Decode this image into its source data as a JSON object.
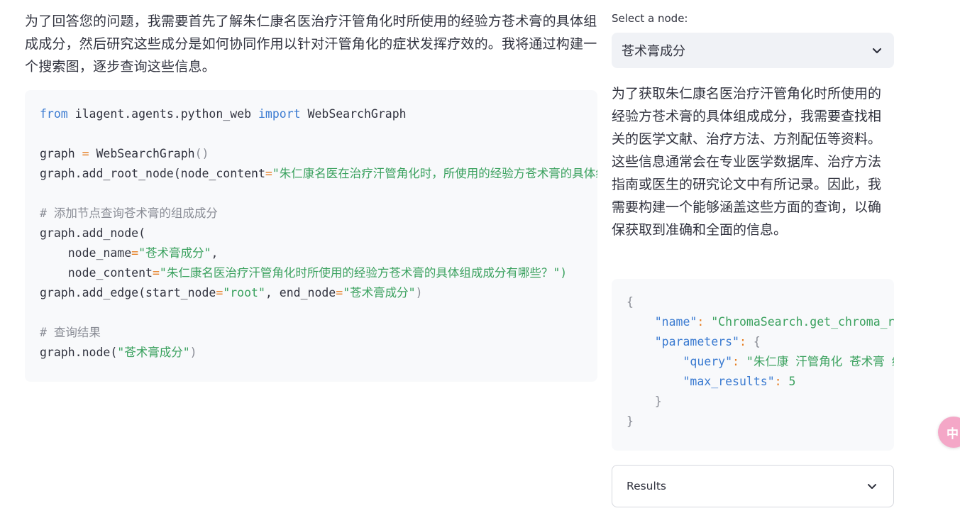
{
  "intro": {
    "text": "为了回答您的问题，我需要首先了解朱仁康名医治疗汗管角化时所使用的经验方苍术膏的具体组成成分，然后研究这些成分是如何协同作用以针对汗管角化的症状发挥疗效的。我将通过构建一个搜索图，逐步查询这些信息。"
  },
  "code": {
    "line1_from": "from",
    "line1_module": " ilagent.agents.python_web ",
    "line1_import": "import",
    "line1_name": " WebSearchGraph",
    "line3_var": "graph",
    "line3_eq": " = ",
    "line3_call": "WebSearchGraph",
    "line3_paren": "()",
    "line4_call": "graph.add_root_node(node_content",
    "line4_eq": "=",
    "line4_str": "\"朱仁康名医在治疗汗管角化时，所使用的经验方苍术膏的具体组成成分有哪些？\"",
    "line6_comment": "# 添加节点查询苍术膏的组成成分",
    "line7_call": "graph.add_node(",
    "line8_key": "    node_name",
    "line8_eq": "=",
    "line8_str": "\"苍术膏成分\"",
    "line8_comma": ",",
    "line9_key": "    node_content",
    "line9_eq": "=",
    "line9_str": "\"朱仁康名医治疗汗管角化时所使用的经验方苍术膏的具体组成成分有哪些？\")",
    "line10_call": "graph.add_edge(start_node",
    "line10_eq1": "=",
    "line10_str1": "\"root\"",
    "line10_mid": ", end_node",
    "line10_eq2": "=",
    "line10_str2": "\"苍术膏成分\"",
    "line10_close": ")",
    "line12_comment": "# 查询结果",
    "line13_call": "graph.node(",
    "line13_str": "\"苍术膏成分\"",
    "line13_close": ")"
  },
  "selector": {
    "label": "Select a node:",
    "value": "苍术膏成分"
  },
  "description": "为了获取朱仁康名医治疗汗管角化时所使用的经验方苍术膏的具体组成成分，我需要查找相关的医学文献、治疗方法、方剂配伍等资料。这些信息通常会在专业医学数据库、治疗方法指南或医生的研究论文中有所记录。因此，我需要构建一个能够涵盖这些方面的查询，以确保获取到准确和全面的信息。",
  "json_block": {
    "open": "{",
    "name_key": "\"name\"",
    "name_val": "\"ChromaSearch.get_chroma_results\"",
    "params_key": "\"parameters\"",
    "params_open": "{",
    "query_key": "\"query\"",
    "query_val": "\"朱仁康 汗管角化 苍术膏 组成成分\"",
    "max_key": "\"max_results\"",
    "max_val": "5",
    "params_close": "}",
    "close": "}"
  },
  "results": {
    "label": "Results"
  },
  "fab": {
    "glyph": "中"
  }
}
